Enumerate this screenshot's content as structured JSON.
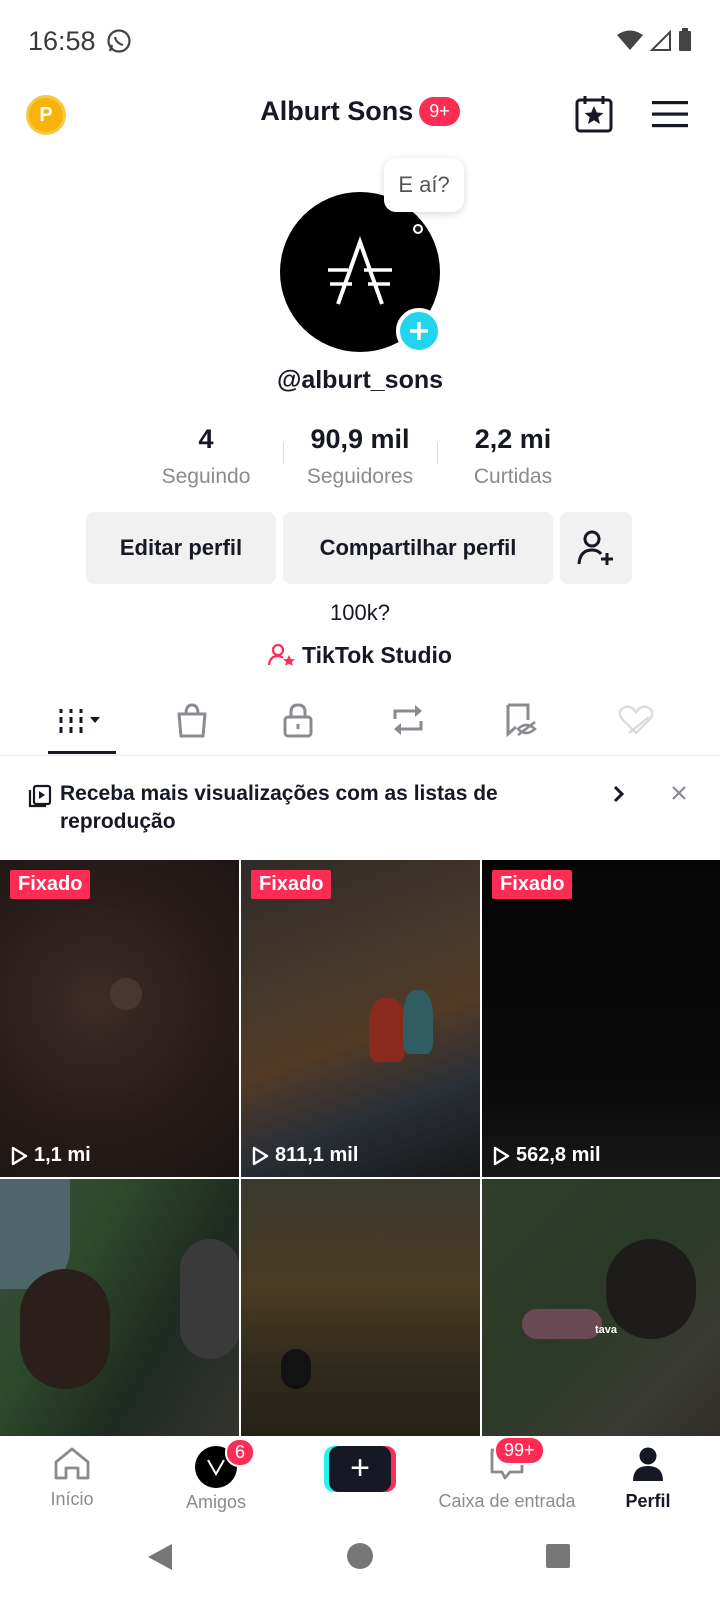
{
  "status_bar": {
    "time": "16:58"
  },
  "header": {
    "coin_letter": "P",
    "title": "Alburt Sons",
    "badge": "9+"
  },
  "profile": {
    "bubble_text": "E aí?",
    "username": "@alburt_sons",
    "stats": [
      {
        "value": "4",
        "label": "Seguindo"
      },
      {
        "value": "90,9 mil",
        "label": "Seguidores"
      },
      {
        "value": "2,2 mi",
        "label": "Curtidas"
      }
    ],
    "buttons": {
      "edit": "Editar perfil",
      "share": "Compartilhar perfil"
    },
    "bio": "100k?",
    "studio_link": "TikTok Studio"
  },
  "banner": {
    "text": "Receba mais visualizações com as listas de reprodução"
  },
  "videos": [
    {
      "pinned": "Fixado",
      "views": "1,1 mi"
    },
    {
      "pinned": "Fixado",
      "views": "811,1 mil"
    },
    {
      "pinned": "Fixado",
      "views": "562,8 mil"
    },
    {
      "pinned": "",
      "views": ""
    },
    {
      "pinned": "",
      "views": ""
    },
    {
      "pinned": "",
      "views": "",
      "overlay": "tava"
    }
  ],
  "bottom_nav": {
    "home": "Início",
    "friends": "Amigos",
    "friends_badge": "6",
    "inbox": "Caixa de entrada",
    "inbox_badge": "99+",
    "profile": "Perfil"
  },
  "colors": {
    "accent": "#fe2c55",
    "cyan": "#20d5ec",
    "coin": "#f9b20a"
  }
}
